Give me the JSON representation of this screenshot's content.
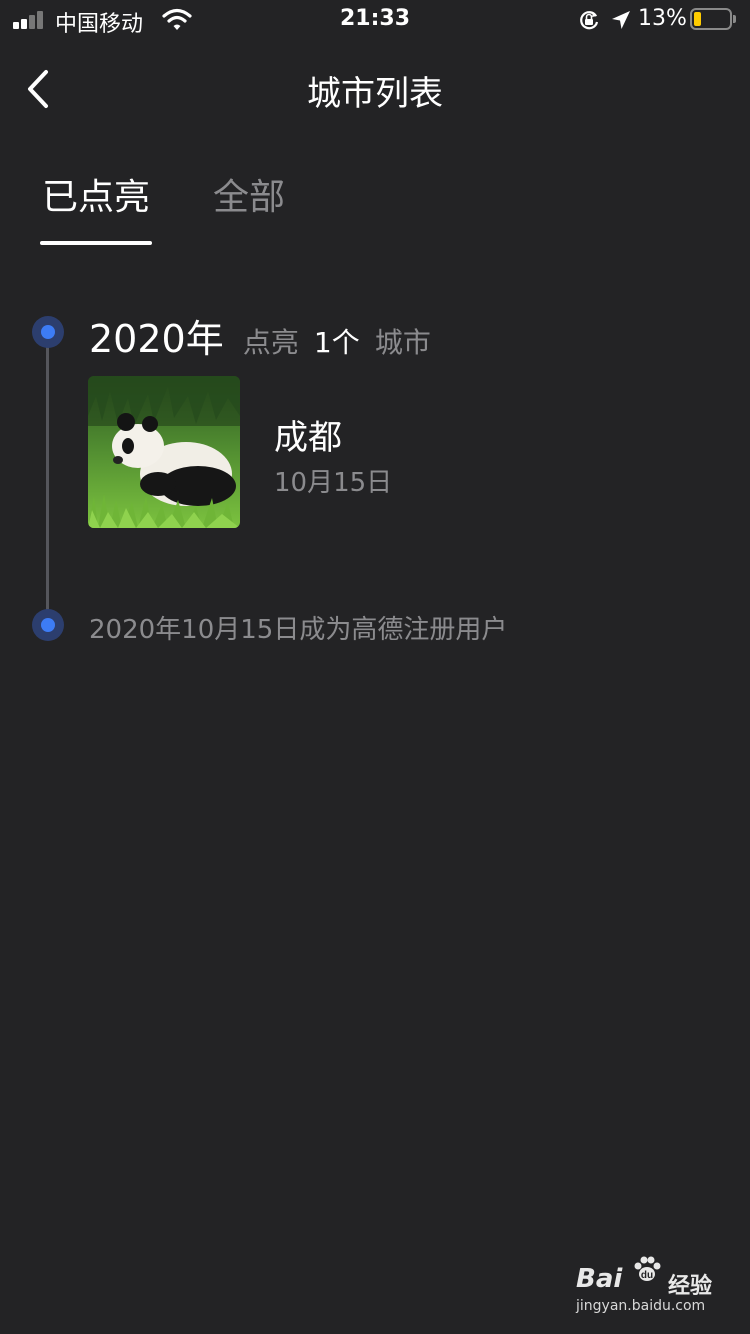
{
  "status_bar": {
    "carrier": "中国移动",
    "time": "21:33",
    "battery_percent": "13%",
    "battery_level": 0.13,
    "signal_bars": 2,
    "icons": [
      "signal-icon",
      "wifi-icon",
      "orientation-lock-icon",
      "location-arrow-icon",
      "battery-icon"
    ]
  },
  "nav": {
    "back_icon": "chevron-left-icon",
    "title": "城市列表"
  },
  "tabs": [
    {
      "label": "已点亮",
      "active": true
    },
    {
      "label": "全部",
      "active": false
    }
  ],
  "timeline": {
    "year_label": "2020年",
    "lit_word": "点亮",
    "lit_count": "1个",
    "lit_unit": "城市",
    "cities": [
      {
        "name": "成都",
        "date": "10月15日",
        "image": "panda-photo"
      }
    ],
    "register_text": "2020年10月15日成为高德注册用户"
  },
  "colors": {
    "background": "#232325",
    "accent_blue": "#3d7cf5",
    "secondary_text": "#8b8b8e"
  },
  "watermark": {
    "logo": "Bai",
    "logo_suffix": "经验",
    "url": "jingyan.baidu.com"
  }
}
